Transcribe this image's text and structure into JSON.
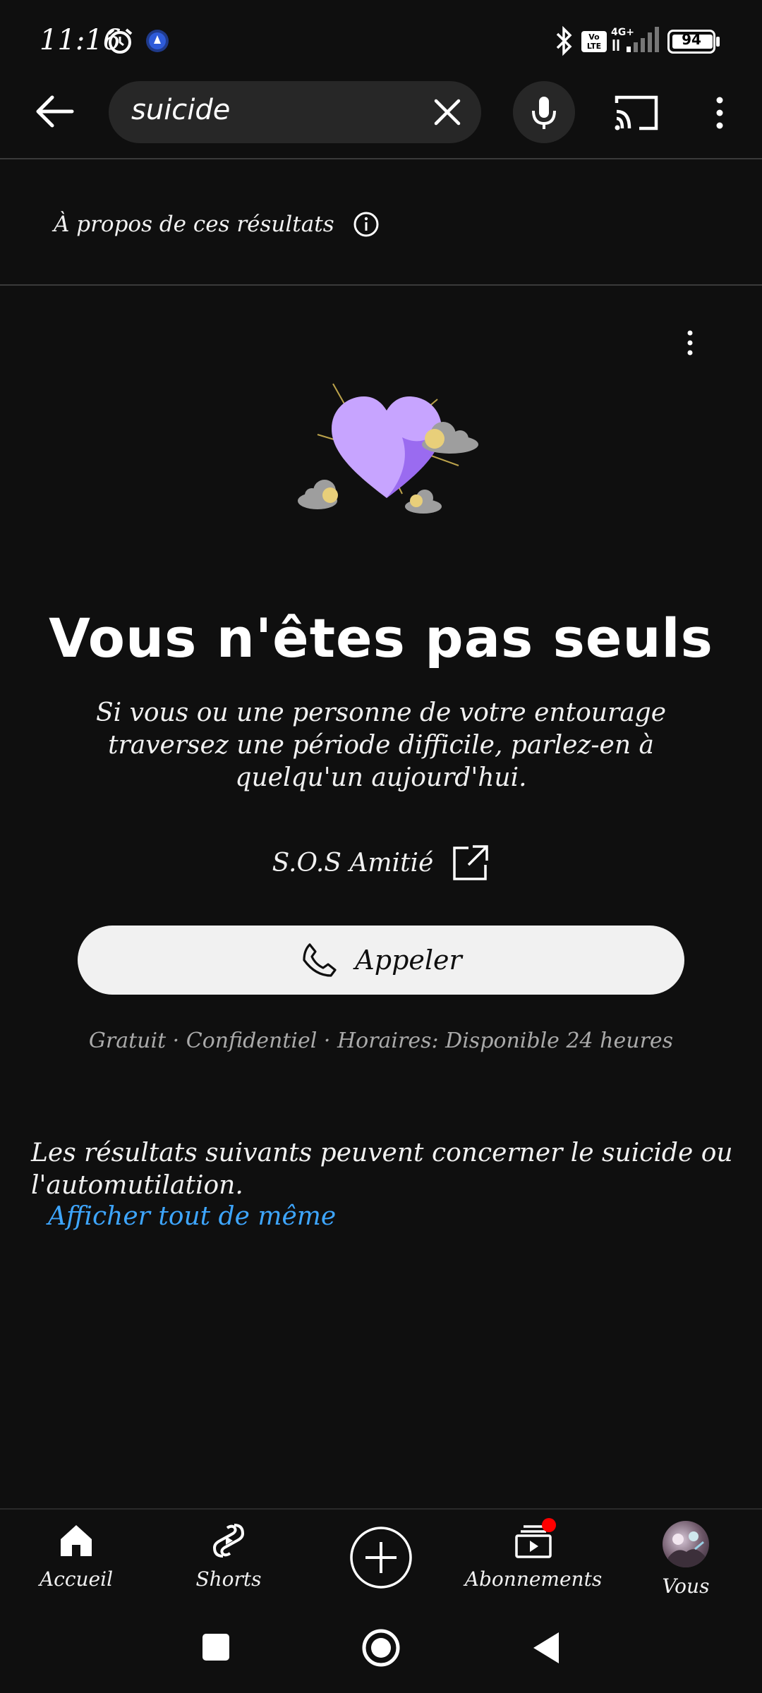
{
  "status_bar": {
    "time": "11:16",
    "network": "4G+",
    "volte": "Vo LTE",
    "battery": "94"
  },
  "search": {
    "query": "suicide"
  },
  "about": {
    "label": "À propos de ces résultats"
  },
  "crisis_card": {
    "title": "Vous n'êtes pas seuls",
    "body": "Si vous ou une personne de votre entourage traversez une période difficile, parlez-en à quelqu'un aujourd'hui.",
    "helpline_name": "S.O.S Amitié",
    "call_label": "Appeler",
    "info": "Gratuit · Confidentiel · Horaires: Disponible 24 heures"
  },
  "warning": {
    "text": "Les résultats suivants peuvent concerner le suicide ou l'automutilation.",
    "link": "Afficher tout de même"
  },
  "bottom_nav": {
    "items": [
      {
        "label": "Accueil",
        "icon": "home-icon"
      },
      {
        "label": "Shorts",
        "icon": "shorts-icon"
      },
      {
        "label": "",
        "icon": "create-icon"
      },
      {
        "label": "Abonnements",
        "icon": "subscriptions-icon"
      },
      {
        "label": "Vous",
        "icon": "avatar"
      }
    ]
  },
  "colors": {
    "background": "#0f0f0f",
    "link": "#3ea6ff",
    "notification": "#ff0000",
    "heart": "#b88cff"
  }
}
